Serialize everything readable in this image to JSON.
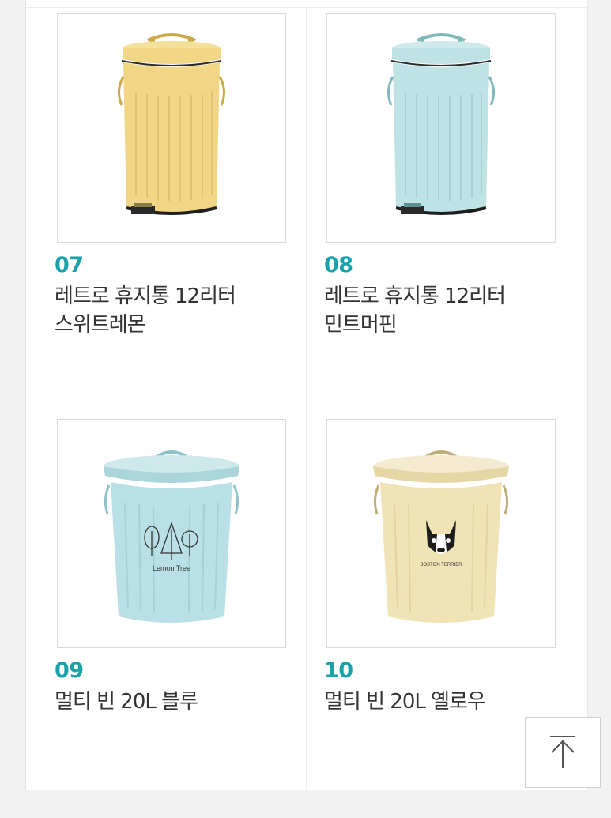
{
  "products": [
    {
      "number": "07",
      "title_line1": "레트로 휴지통 12리터",
      "title_line2": "스위트레몬",
      "color": "#f1d685",
      "icon": "pedal-bin-yellow-image"
    },
    {
      "number": "08",
      "title_line1": "레트로 휴지통 12리터",
      "title_line2": "민트머핀",
      "color": "#bfe3e5",
      "icon": "pedal-bin-mint-image"
    },
    {
      "number": "09",
      "title_line1": "멀티 빈 20L 블루",
      "title_line2": "",
      "color": "#b9e0e6",
      "icon": "multi-bin-blue-image",
      "print_text": "Lemon Tree"
    },
    {
      "number": "10",
      "title_line1": "멀티 빈 20L 옐로우",
      "title_line2": "",
      "color": "#f0e3b6",
      "icon": "multi-bin-yellow-image",
      "print_text": "BOSTON TERRIER"
    }
  ],
  "scroll_top": {
    "icon": "arrow-up-icon"
  }
}
